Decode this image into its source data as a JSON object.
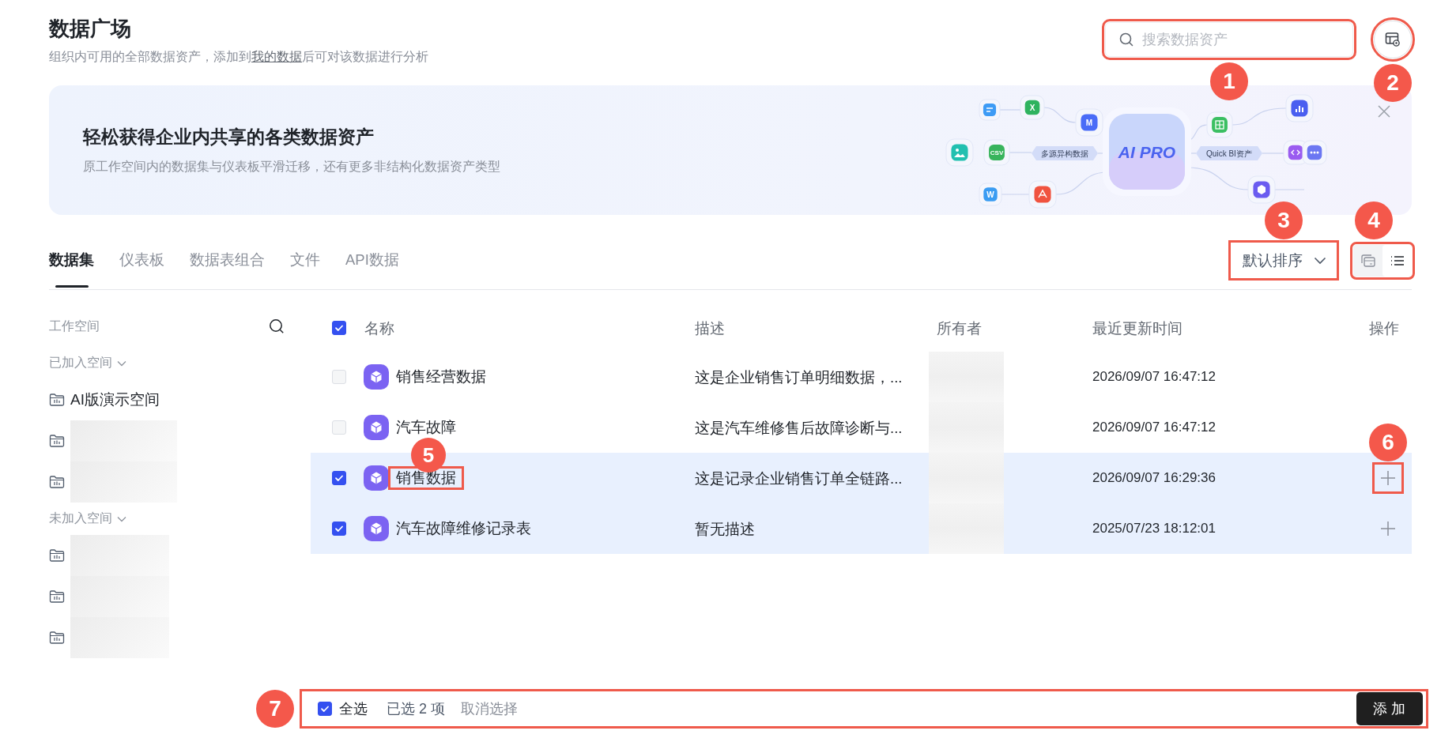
{
  "header": {
    "title": "数据广场",
    "subtitle": {
      "before": "组织内可用的全部数据资产，添加到",
      "link": "我的数据",
      "after": "后可对该数据进行分析"
    },
    "search": {
      "placeholder": "搜索数据资产",
      "callout": "1"
    },
    "settings_button": {
      "callout": "2"
    }
  },
  "banner": {
    "title": "轻松获得企业内共享的各类数据资产",
    "description": "原工作空间内的数据集与仪表板平滑迁移，还有更多非结构化数据资产类型",
    "diagram": {
      "center": "AI PRO",
      "left_label": "多源异构数据",
      "right_label": "Quick BI资产",
      "nodes": [
        {
          "kind": "doc",
          "color": "#3d9bf5"
        },
        {
          "kind": "letter",
          "label": "X",
          "color": "#2fb35f"
        },
        {
          "kind": "letter",
          "label": "M",
          "color": "#4a6cf7"
        },
        {
          "kind": "image",
          "color": "#22c0b0"
        },
        {
          "kind": "letter",
          "label": "CSV",
          "color": "#38b45c"
        },
        {
          "kind": "letter",
          "label": "W",
          "color": "#3a9cf2"
        },
        {
          "kind": "pdf",
          "color": "#f0533f"
        },
        {
          "kind": "sheet",
          "color": "#3bbf62"
        },
        {
          "kind": "chart",
          "color": "#4a5ff0"
        },
        {
          "kind": "code",
          "color": "#9a5cf0"
        },
        {
          "kind": "more",
          "color": "#6b77f2"
        },
        {
          "kind": "cube",
          "color": "#6b5cf0"
        }
      ]
    }
  },
  "tabs": [
    {
      "label": "数据集",
      "selected": true
    },
    {
      "label": "仪表板",
      "selected": false
    },
    {
      "label": "数据表组合",
      "selected": false
    },
    {
      "label": "文件",
      "selected": false
    },
    {
      "label": "API数据",
      "selected": false
    }
  ],
  "sort": {
    "label": "默认排序",
    "callout": "3"
  },
  "view_toggle": {
    "callout": "4",
    "views": [
      {
        "kind": "card",
        "selected": false
      },
      {
        "kind": "list",
        "selected": true
      }
    ]
  },
  "sidebar": {
    "title": "工作空间",
    "groups": [
      {
        "label": "已加入空间",
        "expanded": true,
        "items": [
          {
            "kind": "workspace",
            "label": "AI版演示空间"
          },
          {
            "kind": "blurred"
          },
          {
            "kind": "blurred"
          }
        ]
      },
      {
        "label": "未加入空间",
        "expanded": true,
        "items": [
          {
            "kind": "blurred"
          },
          {
            "kind": "blurred"
          },
          {
            "kind": "blurred"
          }
        ]
      }
    ]
  },
  "table": {
    "all_checked": true,
    "columns": [
      "名称",
      "描述",
      "所有者",
      "最近更新时间",
      "操作"
    ],
    "rows": [
      {
        "selected": false,
        "name": "销售经营数据",
        "description": "这是企业销售订单明细数据，...",
        "owner": {
          "kind": "blurred"
        },
        "updated": "2026/09/07 16:47:12"
      },
      {
        "selected": false,
        "name": "汽车故障",
        "description": "这是汽车维修售后故障诊断与...",
        "owner": {
          "kind": "blurred"
        },
        "updated": "2026/09/07 16:47:12"
      },
      {
        "selected": true,
        "name": "销售数据",
        "name_callout": "5",
        "description": "这是记录企业销售订单全链路...",
        "owner": {
          "kind": "blurred"
        },
        "updated": "2026/09/07 16:29:36",
        "action_callout": "6"
      },
      {
        "selected": true,
        "name": "汽车故障维修记录表",
        "description": "暂无描述",
        "owner": {
          "kind": "blurred"
        },
        "updated": "2025/07/23 18:12:01"
      }
    ]
  },
  "footer": {
    "callout": "7",
    "select_all": {
      "label": "全选",
      "checked": true
    },
    "count": "已选 2 项",
    "clear": "取消选择",
    "add_button": "添 加"
  }
}
